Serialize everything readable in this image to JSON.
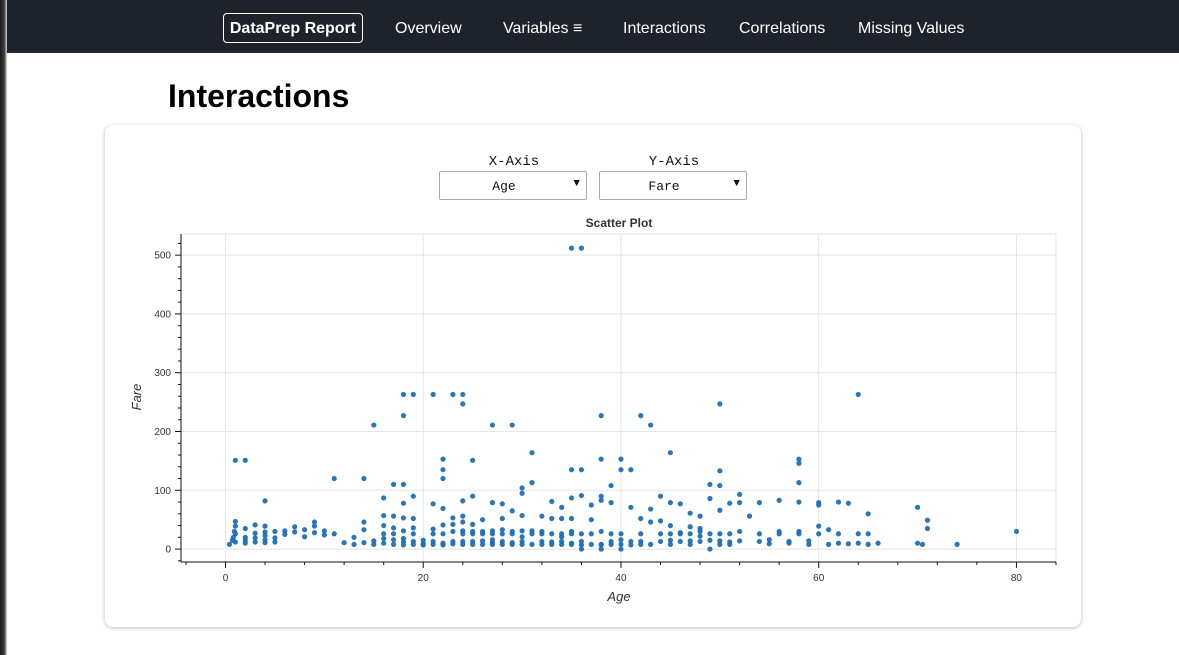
{
  "nav": {
    "brand": "DataPrep Report",
    "items": [
      "Overview",
      "Variables ≡",
      "Interactions",
      "Correlations",
      "Missing Values"
    ]
  },
  "page_title": "Interactions",
  "controls": {
    "x_label": "X-Axis",
    "y_label": "Y-Axis",
    "x_value": "Age",
    "y_value": "Fare",
    "caret": "▼"
  },
  "colors": {
    "nav_bg": "#1e232b",
    "point": "#1f6fb4"
  },
  "chart_data": {
    "type": "scatter",
    "title": "Scatter Plot",
    "xlabel": "Age",
    "ylabel": "Fare",
    "xlim": [
      -4.5,
      84
    ],
    "ylim": [
      -22,
      536
    ],
    "xticks": [
      0,
      20,
      40,
      60,
      80
    ],
    "yticks": [
      0,
      100,
      200,
      300,
      400,
      500
    ],
    "grid": true,
    "points": [
      [
        35,
        512
      ],
      [
        36,
        512
      ],
      [
        18,
        263
      ],
      [
        19,
        263
      ],
      [
        21,
        263
      ],
      [
        23,
        263
      ],
      [
        24,
        263
      ],
      [
        24,
        247
      ],
      [
        64,
        263
      ],
      [
        18,
        227
      ],
      [
        38,
        227
      ],
      [
        42,
        227
      ],
      [
        50,
        247
      ],
      [
        43,
        211
      ],
      [
        15,
        211
      ],
      [
        27,
        211
      ],
      [
        29,
        211
      ],
      [
        31,
        164
      ],
      [
        45,
        164
      ],
      [
        58,
        153
      ],
      [
        58,
        146
      ],
      [
        38,
        153
      ],
      [
        40,
        153
      ],
      [
        22,
        153
      ],
      [
        1,
        151
      ],
      [
        2,
        151
      ],
      [
        25,
        151
      ],
      [
        11,
        120
      ],
      [
        14,
        120
      ],
      [
        17,
        110
      ],
      [
        18,
        110
      ],
      [
        22,
        135
      ],
      [
        22,
        120
      ],
      [
        35,
        135
      ],
      [
        36,
        135
      ],
      [
        40,
        135
      ],
      [
        41,
        135
      ],
      [
        50,
        133
      ],
      [
        58,
        113
      ],
      [
        4,
        82
      ],
      [
        16,
        87
      ],
      [
        19,
        90
      ],
      [
        24,
        82
      ],
      [
        25,
        90
      ],
      [
        27,
        79
      ],
      [
        28,
        77
      ],
      [
        29,
        65
      ],
      [
        30,
        104
      ],
      [
        30,
        95
      ],
      [
        31,
        113
      ],
      [
        33,
        81
      ],
      [
        34,
        71
      ],
      [
        35,
        87
      ],
      [
        36,
        91
      ],
      [
        37,
        75
      ],
      [
        38,
        90
      ],
      [
        38,
        83
      ],
      [
        39,
        79
      ],
      [
        39,
        108
      ],
      [
        41,
        71
      ],
      [
        43,
        68
      ],
      [
        44,
        90
      ],
      [
        45,
        79
      ],
      [
        46,
        77
      ],
      [
        47,
        61
      ],
      [
        48,
        56
      ],
      [
        49,
        86
      ],
      [
        49,
        110
      ],
      [
        50,
        108
      ],
      [
        50,
        66
      ],
      [
        51,
        78
      ],
      [
        52,
        93
      ],
      [
        52,
        79
      ],
      [
        53,
        56
      ],
      [
        54,
        79
      ],
      [
        56,
        83
      ],
      [
        58,
        80
      ],
      [
        60,
        75
      ],
      [
        60,
        79
      ],
      [
        62,
        80
      ],
      [
        63,
        78
      ],
      [
        65,
        60
      ],
      [
        70,
        71
      ],
      [
        71,
        49
      ],
      [
        71,
        35
      ],
      [
        21,
        77
      ],
      [
        22,
        69
      ],
      [
        23,
        53
      ],
      [
        24,
        56
      ],
      [
        26,
        50
      ],
      [
        28,
        52
      ],
      [
        30,
        57
      ],
      [
        32,
        56
      ],
      [
        33,
        52
      ],
      [
        34,
        52
      ],
      [
        35,
        52
      ],
      [
        37,
        50
      ],
      [
        42,
        52
      ],
      [
        43,
        46
      ],
      [
        44,
        48
      ],
      [
        45,
        40
      ],
      [
        47,
        38
      ],
      [
        48,
        30
      ],
      [
        46,
        28
      ],
      [
        0.4,
        8
      ],
      [
        0.7,
        15
      ],
      [
        0.8,
        20
      ],
      [
        0.9,
        30
      ],
      [
        1,
        39
      ],
      [
        1,
        47
      ],
      [
        1,
        12
      ],
      [
        1,
        26
      ],
      [
        2,
        35
      ],
      [
        2,
        20
      ],
      [
        2,
        15
      ],
      [
        2,
        10
      ],
      [
        3,
        41
      ],
      [
        3,
        27
      ],
      [
        3,
        19
      ],
      [
        3,
        12
      ],
      [
        4,
        39
      ],
      [
        4,
        29
      ],
      [
        4,
        23
      ],
      [
        4,
        16
      ],
      [
        4,
        11
      ],
      [
        5,
        30
      ],
      [
        5,
        19
      ],
      [
        5,
        12
      ],
      [
        6,
        31
      ],
      [
        6,
        25
      ],
      [
        7,
        38
      ],
      [
        7,
        29
      ],
      [
        8,
        33
      ],
      [
        8,
        21
      ],
      [
        9,
        46
      ],
      [
        9,
        39
      ],
      [
        9,
        28
      ],
      [
        10,
        31
      ],
      [
        10,
        24
      ],
      [
        11,
        26
      ],
      [
        12,
        11
      ],
      [
        13,
        20
      ],
      [
        13,
        8
      ],
      [
        14,
        46
      ],
      [
        14,
        33
      ],
      [
        14,
        11
      ],
      [
        15,
        14
      ],
      [
        15,
        8
      ],
      [
        16,
        57
      ],
      [
        16,
        40
      ],
      [
        16,
        26
      ],
      [
        16,
        18
      ],
      [
        16,
        10
      ],
      [
        17,
        56
      ],
      [
        17,
        36
      ],
      [
        17,
        26
      ],
      [
        17,
        16
      ],
      [
        17,
        8
      ],
      [
        18,
        78
      ],
      [
        18,
        53
      ],
      [
        18,
        31
      ],
      [
        18,
        18
      ],
      [
        18,
        12
      ],
      [
        18,
        7
      ],
      [
        19,
        52
      ],
      [
        19,
        36
      ],
      [
        19,
        26
      ],
      [
        19,
        13
      ],
      [
        19,
        8
      ],
      [
        20,
        7
      ],
      [
        20,
        9
      ],
      [
        20,
        15
      ],
      [
        21,
        8
      ],
      [
        21,
        13
      ],
      [
        21,
        26
      ],
      [
        21,
        34
      ],
      [
        22,
        10
      ],
      [
        22,
        26
      ],
      [
        22,
        41
      ],
      [
        22,
        7
      ],
      [
        23,
        9
      ],
      [
        23,
        13
      ],
      [
        23,
        30
      ],
      [
        23,
        42
      ],
      [
        24,
        8
      ],
      [
        24,
        13
      ],
      [
        24,
        26
      ],
      [
        24,
        31
      ],
      [
        24,
        46
      ],
      [
        25,
        8
      ],
      [
        25,
        13
      ],
      [
        25,
        26
      ],
      [
        25,
        30
      ],
      [
        25,
        42
      ],
      [
        26,
        8
      ],
      [
        26,
        14
      ],
      [
        26,
        26
      ],
      [
        26,
        30
      ],
      [
        27,
        8
      ],
      [
        27,
        11
      ],
      [
        27,
        16
      ],
      [
        27,
        26
      ],
      [
        27,
        31
      ],
      [
        28,
        8
      ],
      [
        28,
        13
      ],
      [
        28,
        26
      ],
      [
        28,
        33
      ],
      [
        29,
        8
      ],
      [
        29,
        11
      ],
      [
        29,
        26
      ],
      [
        29,
        30
      ],
      [
        30,
        8
      ],
      [
        30,
        13
      ],
      [
        30,
        21
      ],
      [
        30,
        31
      ],
      [
        31,
        8
      ],
      [
        31,
        26
      ],
      [
        31,
        31
      ],
      [
        32,
        8
      ],
      [
        32,
        13
      ],
      [
        32,
        26
      ],
      [
        32,
        30
      ],
      [
        33,
        8
      ],
      [
        33,
        12
      ],
      [
        33,
        26
      ],
      [
        34,
        8
      ],
      [
        34,
        13
      ],
      [
        34,
        21
      ],
      [
        34,
        26
      ],
      [
        35,
        8
      ],
      [
        35,
        10
      ],
      [
        35,
        26
      ],
      [
        35,
        30
      ],
      [
        36,
        7
      ],
      [
        36,
        13
      ],
      [
        36,
        26
      ],
      [
        36,
        0
      ],
      [
        37,
        8
      ],
      [
        37,
        26
      ],
      [
        38,
        8
      ],
      [
        38,
        7
      ],
      [
        38,
        30
      ],
      [
        38,
        0
      ],
      [
        39,
        8
      ],
      [
        39,
        13
      ],
      [
        39,
        26
      ],
      [
        40,
        8
      ],
      [
        40,
        16
      ],
      [
        40,
        26
      ],
      [
        40,
        0
      ],
      [
        41,
        13
      ],
      [
        41,
        7
      ],
      [
        42,
        8
      ],
      [
        42,
        13
      ],
      [
        42,
        26
      ],
      [
        43,
        8
      ],
      [
        44,
        13
      ],
      [
        44,
        26
      ],
      [
        45,
        8
      ],
      [
        45,
        15
      ],
      [
        45,
        26
      ],
      [
        46,
        13
      ],
      [
        46,
        26
      ],
      [
        47,
        8
      ],
      [
        47,
        14
      ],
      [
        47,
        26
      ],
      [
        48,
        13
      ],
      [
        48,
        22
      ],
      [
        48,
        35
      ],
      [
        49,
        26
      ],
      [
        49,
        0
      ],
      [
        49,
        15
      ],
      [
        50,
        8
      ],
      [
        50,
        14
      ],
      [
        50,
        26
      ],
      [
        51,
        8
      ],
      [
        51,
        26
      ],
      [
        51,
        12
      ],
      [
        52,
        30
      ],
      [
        52,
        14
      ],
      [
        54,
        26
      ],
      [
        54,
        13
      ],
      [
        55,
        16
      ],
      [
        55,
        9
      ],
      [
        56,
        26
      ],
      [
        56,
        30
      ],
      [
        57,
        13
      ],
      [
        57,
        10
      ],
      [
        58,
        26
      ],
      [
        58,
        30
      ],
      [
        59,
        14
      ],
      [
        59,
        8
      ],
      [
        60,
        26
      ],
      [
        60,
        39
      ],
      [
        61,
        33
      ],
      [
        61,
        8
      ],
      [
        62,
        26
      ],
      [
        62,
        10
      ],
      [
        63,
        9
      ],
      [
        64,
        26
      ],
      [
        64,
        10
      ],
      [
        65,
        26
      ],
      [
        65,
        8
      ],
      [
        66,
        10
      ],
      [
        70,
        10
      ],
      [
        70.5,
        8
      ],
      [
        74,
        8
      ],
      [
        80,
        30
      ]
    ]
  }
}
